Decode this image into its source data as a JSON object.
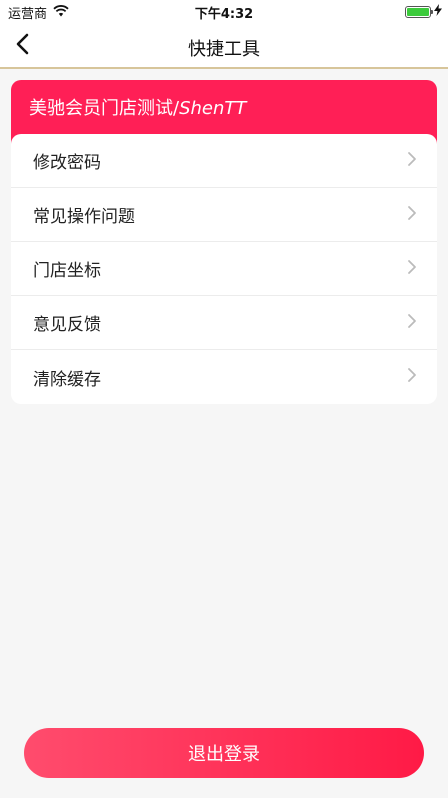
{
  "status_bar": {
    "carrier": "运营商",
    "time": "下午4:32",
    "battery_level": 1.0,
    "battery_color": "#3ccb3c"
  },
  "nav": {
    "title": "快捷工具",
    "back_icon": "chevron-left-icon"
  },
  "store": {
    "name": "美驰会员门店测试/",
    "name_en": "ShenTT",
    "color": "#ff1f56"
  },
  "menu": {
    "items": [
      {
        "label": "修改密码",
        "icon": "chevron-right-icon"
      },
      {
        "label": "常见操作问题",
        "icon": "chevron-right-icon"
      },
      {
        "label": "门店坐标",
        "icon": "chevron-right-icon"
      },
      {
        "label": "意见反馈",
        "icon": "chevron-right-icon"
      },
      {
        "label": "清除缓存",
        "icon": "chevron-right-icon"
      }
    ]
  },
  "logout": {
    "label": "退出登录",
    "color": "#ff1a46"
  }
}
